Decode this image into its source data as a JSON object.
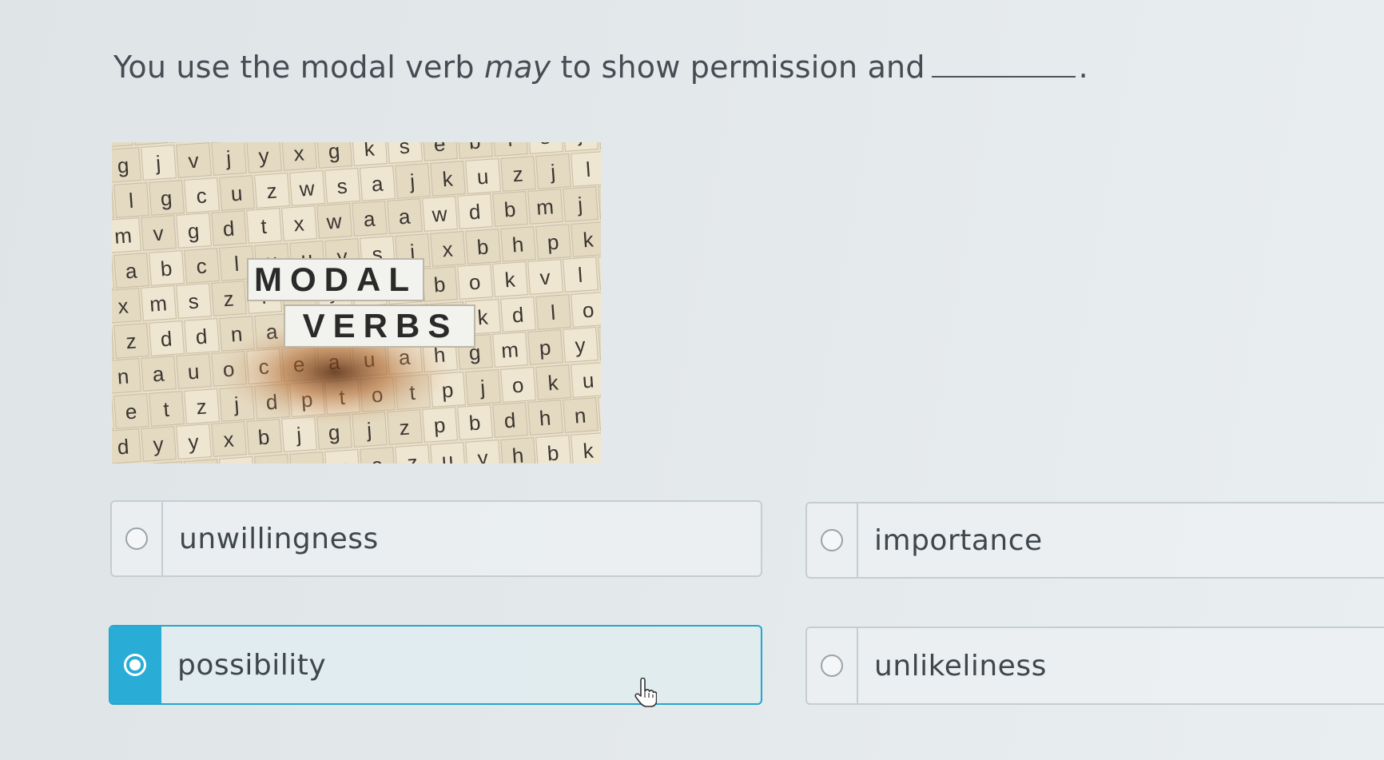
{
  "question": {
    "before": "You use the modal verb ",
    "emphasis": "may",
    "after": " to show permission and",
    "end": "."
  },
  "image": {
    "word1": "MODAL",
    "word2": "VERBS"
  },
  "options": [
    {
      "label": "unwillingness",
      "selected": false
    },
    {
      "label": "importance",
      "selected": false
    },
    {
      "label": "possibility",
      "selected": true
    },
    {
      "label": "unlikeliness",
      "selected": false
    }
  ],
  "colors": {
    "accent": "#29acd6",
    "text": "#3f474d",
    "border": "#c6cdd1"
  },
  "cursor_icon": "hand-pointer-icon"
}
